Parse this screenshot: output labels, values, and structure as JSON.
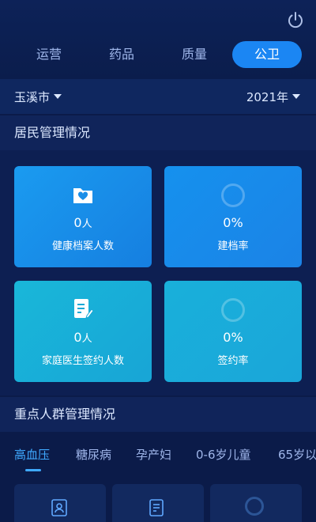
{
  "tabs": [
    {
      "label": "运营",
      "active": false
    },
    {
      "label": "药品",
      "active": false
    },
    {
      "label": "质量",
      "active": false
    },
    {
      "label": "公卫",
      "active": true
    }
  ],
  "filters": {
    "city": "玉溪市",
    "year": "2021年"
  },
  "resident_section": {
    "title": "居民管理情况",
    "cards": [
      {
        "value": "0",
        "unit": "人",
        "label": "健康档案人数",
        "icon": "folder-heart-icon"
      },
      {
        "value": "0%",
        "unit": "",
        "label": "建档率",
        "icon": "ring-icon"
      },
      {
        "value": "0",
        "unit": "人",
        "label": "家庭医生签约人数",
        "icon": "document-edit-icon"
      },
      {
        "value": "0%",
        "unit": "",
        "label": "签约率",
        "icon": "ring-icon"
      }
    ]
  },
  "key_section": {
    "title": "重点人群管理情况",
    "subtabs": [
      "高血压",
      "糖尿病",
      "孕产妇",
      "0-6岁儿童",
      "65岁以"
    ],
    "active_subtab": "高血压"
  },
  "colors": {
    "accent": "#1b86f3",
    "active_text": "#3fa9ff",
    "background": "#0b1b49"
  }
}
